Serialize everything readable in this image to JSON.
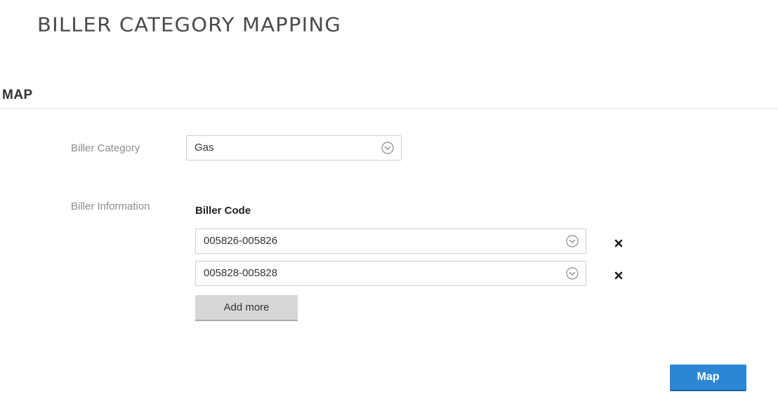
{
  "header": {
    "title": "BILLER CATEGORY MAPPING"
  },
  "section": {
    "title": "MAP"
  },
  "form": {
    "category_label": "Biller Category",
    "category_value": "Gas",
    "info_label": "Biller Information",
    "code_header": "Biller Code",
    "codes": [
      {
        "value": "005826-005826"
      },
      {
        "value": "005828-005828"
      }
    ],
    "add_more_label": "Add more",
    "map_label": "Map"
  },
  "icons": {
    "select_chevron": "chevron-down-circle-icon",
    "remove": "close-icon"
  },
  "colors": {
    "primary_button": "#2c86d6",
    "secondary_button": "#d7d7d7"
  }
}
